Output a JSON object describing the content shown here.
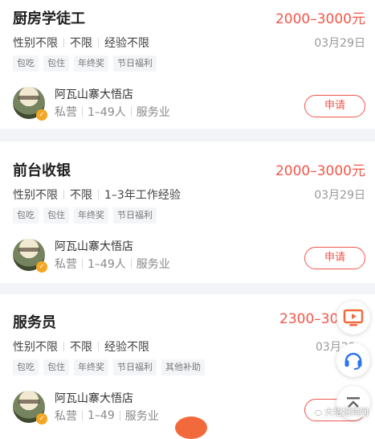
{
  "jobs": [
    {
      "title": "厨房学徒工",
      "salary": "2000–3000元",
      "requirements": [
        "性别不限",
        "不限",
        "经验不限"
      ],
      "date": "03月29日",
      "tags": [
        "包吃",
        "包住",
        "年终奖",
        "节日福利"
      ],
      "company": {
        "name": "阿瓦山寨大悟店",
        "type": "私营",
        "size": "1–49人",
        "industry": "服务业"
      },
      "apply_label": "申请"
    },
    {
      "title": "前台收银",
      "salary": "2000–3000元",
      "requirements": [
        "性别不限",
        "不限",
        "1–3年工作经验"
      ],
      "date": "03月29日",
      "tags": [
        "包吃",
        "包住",
        "年终奖",
        "节日福利"
      ],
      "company": {
        "name": "阿瓦山寨大悟店",
        "type": "私营",
        "size": "1–49人",
        "industry": "服务业"
      },
      "apply_label": "申请"
    },
    {
      "title": "服务员",
      "salary": "2300–30",
      "requirements": [
        "性别不限",
        "不限",
        "经验不限"
      ],
      "date": "03月29",
      "tags": [
        "包吃",
        "包住",
        "年终奖",
        "节日福利",
        "其他补助"
      ],
      "company": {
        "name": "阿瓦山寨大悟店",
        "type": "私营",
        "size": "1–49",
        "industry": "服务业"
      },
      "apply_label": ""
    }
  ],
  "floating": {
    "icons": [
      "live-broadcast-icon",
      "customer-service-headset-icon",
      "back-to-top-icon"
    ],
    "accent": "#f26a3c",
    "service_color": "#2b73f0"
  },
  "watermark": {
    "text": "大悟招聘网"
  },
  "colors": {
    "salary": "#f2574a",
    "background": "#f3f4f7"
  }
}
